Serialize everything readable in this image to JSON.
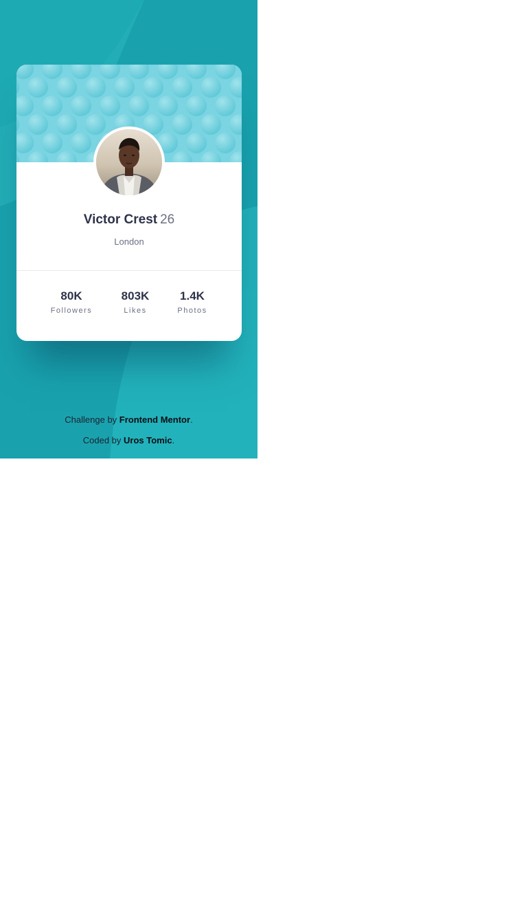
{
  "colors": {
    "background": "#19a2ae",
    "card": "#ffffff",
    "card_pattern": "#7ad4e1",
    "text_primary": "#2e3349",
    "text_secondary": "#6b7082"
  },
  "profile": {
    "name": "Victor Crest",
    "age": "26",
    "location": "London",
    "avatar_icon": "profile-photo"
  },
  "stats": [
    {
      "value": "80K",
      "label": "Followers"
    },
    {
      "value": "803K",
      "label": "Likes"
    },
    {
      "value": "1.4K",
      "label": "Photos"
    }
  ],
  "attribution": {
    "challenge_prefix": "Challenge by ",
    "challenge_link": "Frontend Mentor",
    "coded_prefix": "Coded by ",
    "coded_link": "Uros Tomic",
    "period": "."
  }
}
